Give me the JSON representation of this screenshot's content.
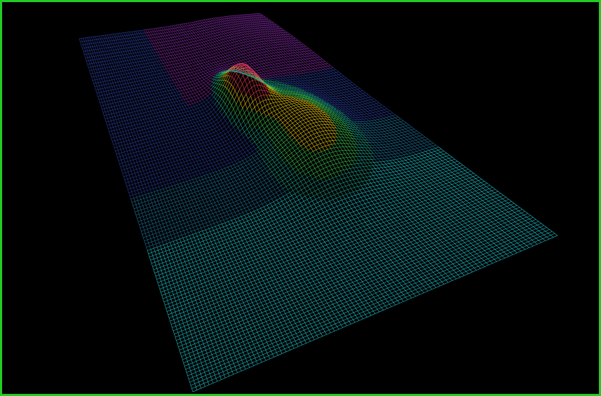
{
  "viewport": {
    "background_color": "#000000",
    "border_color": "#22cc22"
  },
  "surface": {
    "render_style": "wireframe",
    "colormap": [
      "#2a2f8f",
      "#5a1f9a",
      "#8a2a8a",
      "#1f6f8f",
      "#18c8c8",
      "#22aa55",
      "#e0c000",
      "#e03030"
    ]
  }
}
